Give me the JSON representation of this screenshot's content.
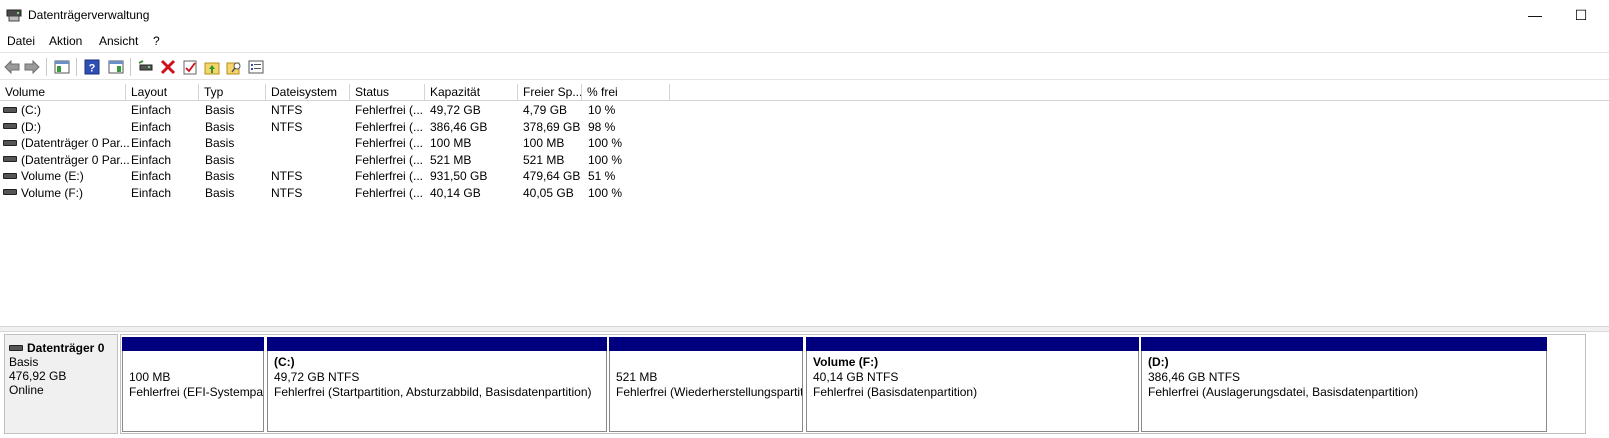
{
  "window": {
    "title": "Datenträgerverwaltung",
    "minimize_glyph": "—",
    "maximize_glyph": "☐"
  },
  "menu": [
    "Datei",
    "Aktion",
    "Ansicht",
    "?"
  ],
  "toolbar": {
    "icons": [
      "back-arrow-icon",
      "forward-arrow-icon",
      "console-tree-icon",
      "help-icon",
      "show-hide-action-pane-icon",
      "connect-disk-icon",
      "delete-icon",
      "properties-check-icon",
      "folder-up-icon",
      "search-folder-icon",
      "list-view-icon"
    ]
  },
  "table": {
    "columns": [
      "Volume",
      "Layout",
      "Typ",
      "Dateisystem",
      "Status",
      "Kapazität",
      "Freier Sp...",
      "% frei"
    ],
    "rows": [
      [
        "(C:)",
        "Einfach",
        "Basis",
        "NTFS",
        "Fehlerfrei (...",
        "49,72 GB",
        "4,79 GB",
        "10 %"
      ],
      [
        "(D:)",
        "Einfach",
        "Basis",
        "NTFS",
        "Fehlerfrei (...",
        "386,46 GB",
        "378,69 GB",
        "98 %"
      ],
      [
        "(Datenträger 0 Par...",
        "Einfach",
        "Basis",
        "",
        "Fehlerfrei (...",
        "100 MB",
        "100 MB",
        "100 %"
      ],
      [
        "(Datenträger 0 Par...",
        "Einfach",
        "Basis",
        "",
        "Fehlerfrei (...",
        "521 MB",
        "521 MB",
        "100 %"
      ],
      [
        "Volume (E:)",
        "Einfach",
        "Basis",
        "NTFS",
        "Fehlerfrei (...",
        "931,50 GB",
        "479,64 GB",
        "51 %"
      ],
      [
        "Volume (F:)",
        "Einfach",
        "Basis",
        "NTFS",
        "Fehlerfrei (...",
        "40,14 GB",
        "40,05 GB",
        "100 %"
      ]
    ]
  },
  "disk": {
    "name": "Datenträger 0",
    "type": "Basis",
    "size": "476,92 GB",
    "state": "Online",
    "partitions": [
      {
        "name": "",
        "size": "100 MB",
        "status": "Fehlerfrei (EFI-Systempart"
      },
      {
        "name": "(C:)",
        "size": "49,72 GB NTFS",
        "status": "Fehlerfrei (Startpartition, Absturzabbild, Basisdatenpartition)"
      },
      {
        "name": "",
        "size": "521 MB",
        "status": "Fehlerfrei (Wiederherstellungspartit"
      },
      {
        "name": "Volume  (F:)",
        "size": "40,14 GB NTFS",
        "status": "Fehlerfrei (Basisdatenpartition)"
      },
      {
        "name": "(D:)",
        "size": "386,46 GB NTFS",
        "status": "Fehlerfrei (Auslagerungsdatei, Basisdatenpartition)"
      }
    ]
  },
  "colors": {
    "partition_bar": "#00007f"
  }
}
